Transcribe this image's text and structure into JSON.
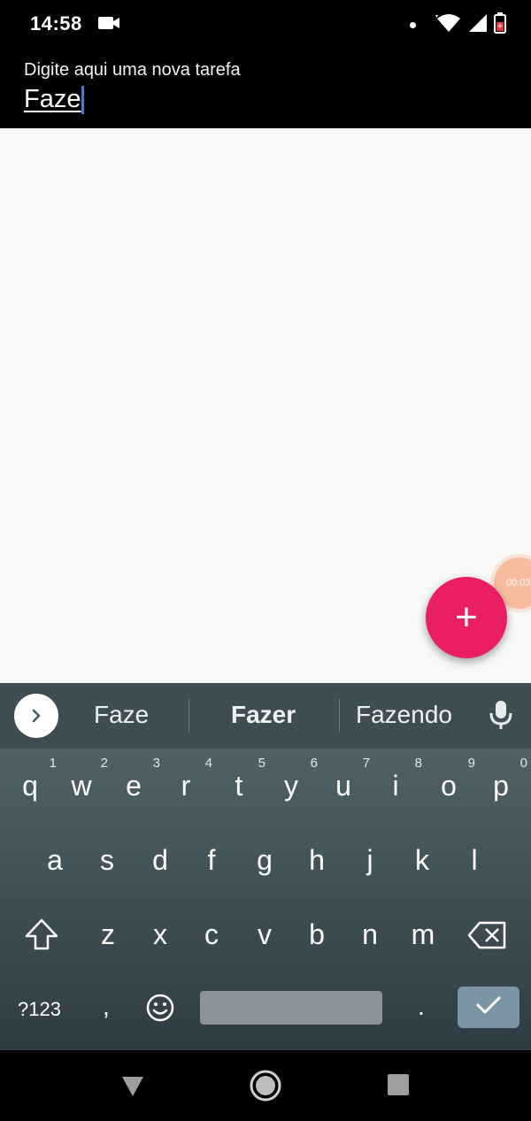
{
  "status_bar": {
    "time": "14:58",
    "icons": [
      "video-camera-icon",
      "notification-dot-icon",
      "wifi-icon",
      "cell-signal-icon",
      "battery-icon"
    ]
  },
  "app_bar": {
    "input_label": "Digite aqui uma nova tarefa",
    "input_value": "Faze"
  },
  "fab": {
    "label": "+",
    "color": "#e91e63"
  },
  "recording_timer": {
    "text": "00:03"
  },
  "keyboard": {
    "suggestions": [
      "Faze",
      "Fazer",
      "Fazendo"
    ],
    "row1": [
      {
        "key": "q",
        "hint": "1"
      },
      {
        "key": "w",
        "hint": "2"
      },
      {
        "key": "e",
        "hint": "3"
      },
      {
        "key": "r",
        "hint": "4"
      },
      {
        "key": "t",
        "hint": "5"
      },
      {
        "key": "y",
        "hint": "6"
      },
      {
        "key": "u",
        "hint": "7"
      },
      {
        "key": "i",
        "hint": "8"
      },
      {
        "key": "o",
        "hint": "9"
      },
      {
        "key": "p",
        "hint": "0"
      }
    ],
    "row2": [
      "a",
      "s",
      "d",
      "f",
      "g",
      "h",
      "j",
      "k",
      "l"
    ],
    "row3": [
      "z",
      "x",
      "c",
      "v",
      "b",
      "n",
      "m"
    ],
    "symbols_key": "?123",
    "comma_key": ",",
    "period_key": "."
  }
}
